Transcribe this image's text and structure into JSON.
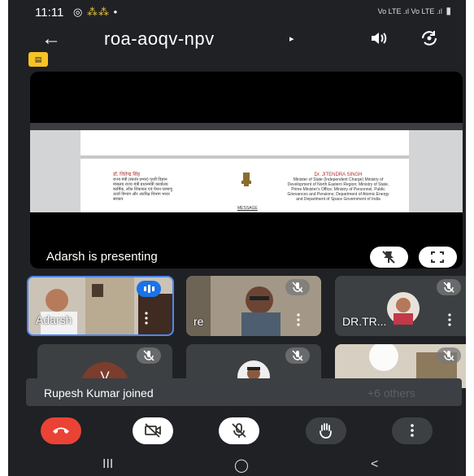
{
  "status": {
    "time": "11:11",
    "notifications": "◎ ⁂⁂",
    "network": "Vo LTE .ıl Vo LTE .ıl"
  },
  "header": {
    "meeting_code": "roa-aoqv-npv",
    "caret": "▸"
  },
  "presentation": {
    "label": "Adarsh is presenting",
    "doc_hindi_title": "डॉ. जितेन्द्र सिंह",
    "doc_hindi_body": "राज्य मंत्री (स्वतंत्र प्रभार) पृथ्वी विज्ञान मंत्रालय राज्य मंत्री प्रधानमंत्री कार्यालय कार्मिक, लोक शिकायत एवं पेंशन परमाणु ऊर्जा विभाग और अंतरिक्ष विभाग भारत सरकार",
    "doc_english_title": "Dr. JITENDRA SINGH",
    "doc_english_body": "Minister of State (Independent Charge) Ministry of Development of North Eastern Region; Ministry of State, Prime Minister's Office; Ministry of Personnel, Public Grievances and Pensions; Department of Atomic Energy and Department of Space Government of India",
    "doc_message": "MESSAGE"
  },
  "tiles": [
    {
      "name": "Adarsh",
      "status": "speaking"
    },
    {
      "name": "re",
      "status": "muted"
    },
    {
      "name": "DR.TR...",
      "status": "muted"
    },
    {
      "name": "",
      "avatar_letter": "V",
      "status": "muted"
    },
    {
      "name": "",
      "status": "muted"
    },
    {
      "name": "",
      "status": "muted"
    }
  ],
  "toast": {
    "text": "Rupesh Kumar joined",
    "ghost_text": "+6 others"
  },
  "colors": {
    "end_call": "#ea4335",
    "accent": "#1a73e8",
    "cc_badge": "#f7c325"
  },
  "icons": {
    "back": "arrow-left-icon",
    "speaker": "speaker-icon",
    "flip": "flip-camera-icon",
    "captions": "captions-icon",
    "pin": "pin-off-icon",
    "fullscreen": "fullscreen-icon",
    "end": "call-end-icon",
    "camera": "camera-off-icon",
    "mic": "mic-off-icon",
    "hand": "raise-hand-icon",
    "more": "more-vert-icon"
  },
  "navbar": {
    "recents": "III",
    "home": "◯",
    "back": "<"
  }
}
